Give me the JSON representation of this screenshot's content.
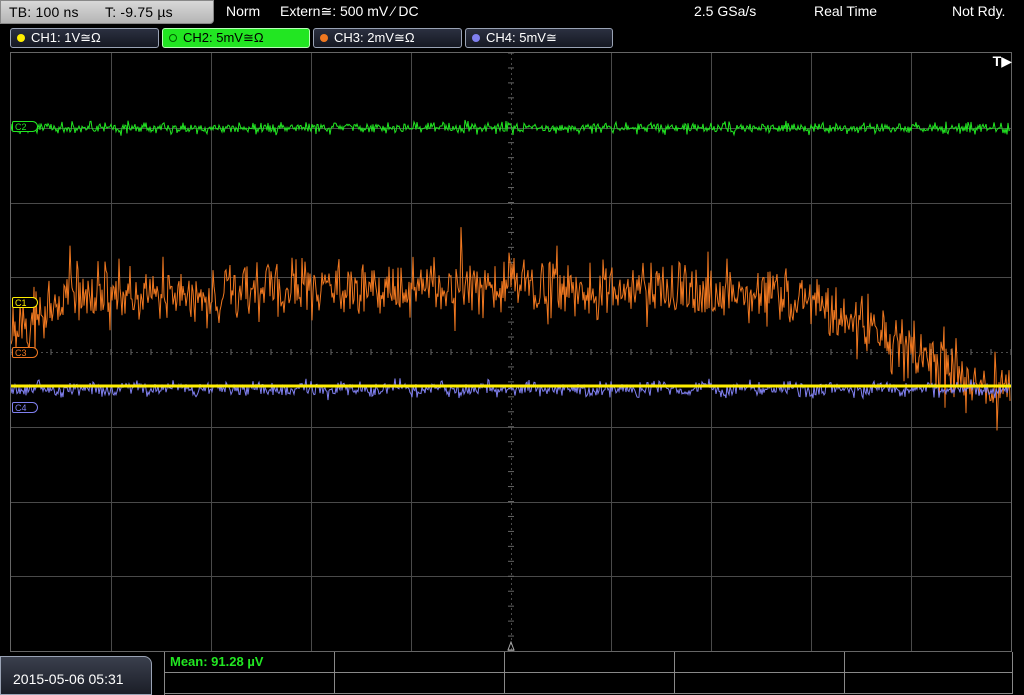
{
  "status": {
    "timebase": "TB: 100 ns",
    "trigger_time": "T: -9.75 µs",
    "trigger_mode": "Norm",
    "trigger_source": "Extern≅: 500 mV ⁄ DC",
    "sample_rate": "2.5 GSa/s",
    "acq_mode": "Real Time",
    "run_state": "Not Rdy."
  },
  "channels": [
    {
      "label": "CH1: 1V≅Ω",
      "color": "#ffee00",
      "active": false,
      "marker": "C1"
    },
    {
      "label": "CH2: 5mV≅Ω",
      "color": "#22e622",
      "active": true,
      "marker": "C2"
    },
    {
      "label": "CH3: 2mV≅Ω",
      "color": "#f07820",
      "active": false,
      "marker": "C3"
    },
    {
      "label": "CH4: 5mV≅",
      "color": "#8080f0",
      "active": false,
      "marker": "C4"
    }
  ],
  "trigger_marker": "T▶",
  "datetime": "2015-05-06 05:31",
  "measurements": {
    "mean": "Mean: 91.28 µV"
  },
  "colors": {
    "grid": "#4a4a4a",
    "ch1": "#ffee00",
    "ch2": "#22e622",
    "ch3": "#f07820",
    "ch4": "#8080f0"
  }
}
